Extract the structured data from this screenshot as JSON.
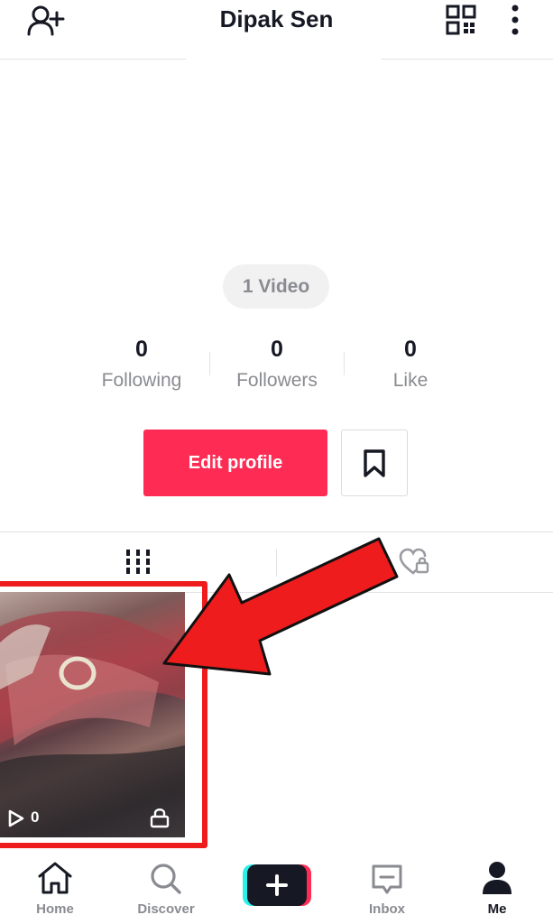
{
  "header": {
    "title": "Dipak Sen",
    "left_icon": "add-user-icon",
    "right_icons": [
      "qr-code-icon",
      "more-vertical-icon"
    ]
  },
  "profile": {
    "video_pill": "1 Video",
    "stats": [
      {
        "value": "0",
        "label": "Following"
      },
      {
        "value": "0",
        "label": "Followers"
      },
      {
        "value": "0",
        "label": "Like"
      }
    ],
    "edit_profile_label": "Edit profile",
    "bookmark_icon": "bookmark-icon"
  },
  "tabs": [
    {
      "icon": "video-grid-icon",
      "active": true
    },
    {
      "icon": "liked-private-icon",
      "active": false
    }
  ],
  "videos": [
    {
      "play_count": "0",
      "icons": [
        "play-icon",
        "lock-icon"
      ]
    }
  ],
  "annotation": {
    "arrow_color": "#ee1c1c"
  },
  "colors": {
    "accent": "#fe2c55",
    "muted_text": "#8a8b91",
    "text": "#161823"
  },
  "bottom_nav": [
    {
      "label": "Home",
      "icon": "home-icon"
    },
    {
      "label": "Discover",
      "icon": "search-icon"
    },
    {
      "label": "",
      "icon": "plus-icon"
    },
    {
      "label": "Inbox",
      "icon": "inbox-icon"
    },
    {
      "label": "Me",
      "icon": "person-icon",
      "active": true
    }
  ]
}
